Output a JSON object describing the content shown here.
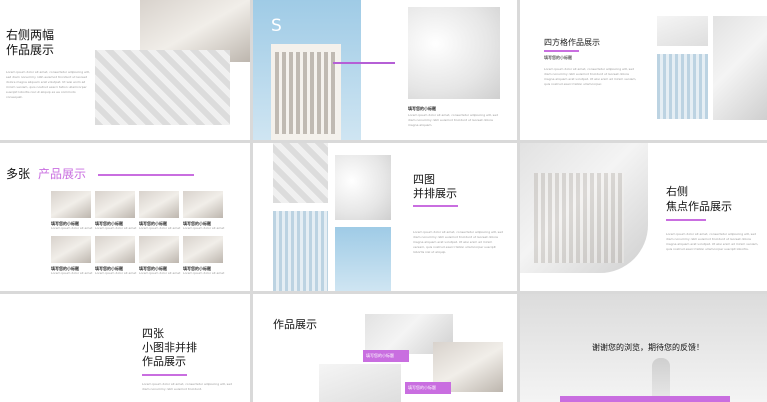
{
  "slide1": {
    "title_line1": "右侧两幅",
    "title_line2": "作品展示",
    "body": "Lorem ipsum dolor sit amet, consectetur adipiscing elit, sed diam nonummy nibh euismod tincidunt ut laoreet dolore magna aliquam erat volutpat. Ut wisi enim ad minim veniam, quis nostrud exerci tation ullamcorper suscipit lobortis nisl ut aliquip ex ea commodo consequat."
  },
  "slide2": {
    "letter": "S",
    "caption": "填写您的小标题",
    "body": "Lorem ipsum dolor sit amet, consectetur adipiscing elit, sed diam nonummy nibh euismod tincidunt ut laoreet dolore magna aliquam."
  },
  "slide3": {
    "title": "四方格作品展示",
    "subtitle": "填写您的小标题",
    "body": "Lorem ipsum dolor sit amet, consectetur adipiscing elit, sed diam nonummy nibh euismod tincidunt ut laoreet dolore magna aliquam erat volutpat. Ut wisi enim ad minim veniam, quis nostrud exerci tation ullamcorper."
  },
  "slide4": {
    "title_black": "多张",
    "title_purple": "产品展示",
    "items": [
      {
        "caption": "填写您的小标题"
      },
      {
        "caption": "填写您的小标题"
      },
      {
        "caption": "填写您的小标题"
      },
      {
        "caption": "填写您的小标题"
      },
      {
        "caption": "填写您的小标题"
      },
      {
        "caption": "填写您的小标题"
      },
      {
        "caption": "填写您的小标题"
      },
      {
        "caption": "填写您的小标题"
      }
    ],
    "item_desc": "Lorem ipsum dolor sit amet"
  },
  "slide5": {
    "title_line1": "四图",
    "title_line2": "并排展示",
    "body": "Lorem ipsum dolor sit amet, consectetur adipiscing elit, sed diam nonummy nibh euismod tincidunt ut laoreet dolore magna aliquam erat volutpat. Ut wisi enim ad minim veniam, quis nostrud exerci tation ullamcorper suscipit lobortis nisl ut aliquip."
  },
  "slide6": {
    "title_line1": "右侧",
    "title_line2": "焦点作品展示",
    "body": "Lorem ipsum dolor sit amet, consectetur adipiscing elit, sed diam nonummy nibh euismod tincidunt ut laoreet dolore magna aliquam erat volutpat. Ut wisi enim ad minim veniam, quis nostrud exerci tation ullamcorper suscipit lobortis."
  },
  "slide7": {
    "title_line1": "四张",
    "title_line2": "小图非并排",
    "title_line3": "作品展示",
    "body": "Lorem ipsum dolor sit amet, consectetur adipiscing elit, sed diam nonummy nibh euismod tincidunt."
  },
  "slide8": {
    "title": "作品展示",
    "caption1": "填写您的小标题",
    "caption2": "填写您的小标题"
  },
  "slide9": {
    "thanks": "谢谢您的浏览，期待您的反馈！"
  },
  "colors": {
    "accent": "#c96ee0"
  }
}
